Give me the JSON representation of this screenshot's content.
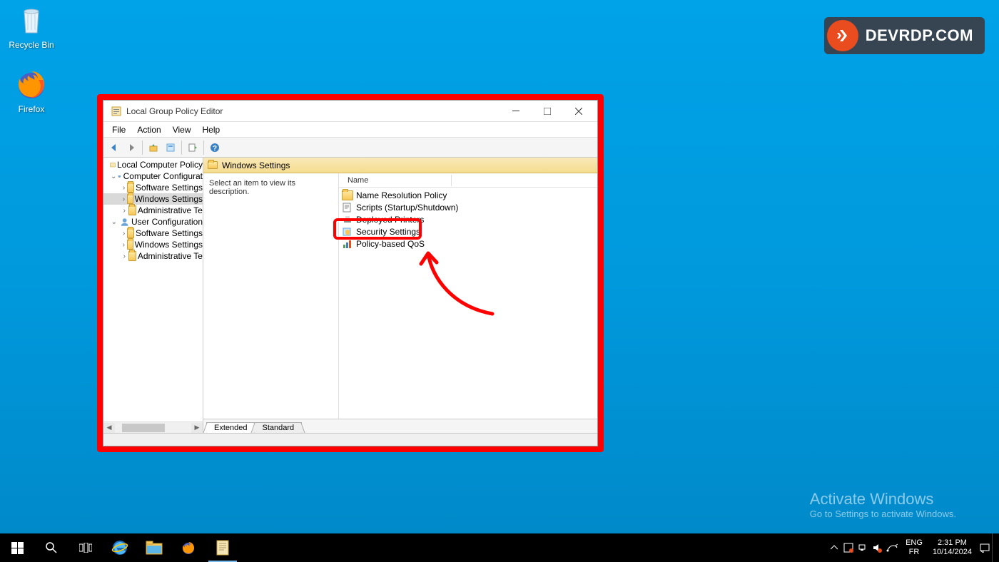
{
  "desktop": {
    "recycle_bin": "Recycle Bin",
    "firefox": "Firefox"
  },
  "brand": {
    "text": "DEVRDP.COM"
  },
  "activate": {
    "title": "Activate Windows",
    "sub": "Go to Settings to activate Windows."
  },
  "window": {
    "title": "Local Group Policy Editor",
    "menu": {
      "file": "File",
      "action": "Action",
      "view": "View",
      "help": "Help"
    },
    "tree": {
      "root": "Local Computer Policy",
      "cc": "Computer Configurat",
      "cc_sw": "Software Settings",
      "cc_win": "Windows Settings",
      "cc_adm": "Administrative Te",
      "uc": "User Configuration",
      "uc_sw": "Software Settings",
      "uc_win": "Windows Settings",
      "uc_adm": "Administrative Te"
    },
    "content": {
      "header": "Windows Settings",
      "desc": "Select an item to view its description.",
      "col_name": "Name",
      "items": {
        "nrp": "Name Resolution Policy",
        "scripts": "Scripts (Startup/Shutdown)",
        "deployed": "Deployed Printers",
        "security": "Security Settings",
        "qos": "Policy-based QoS"
      }
    },
    "tabs": {
      "extended": "Extended",
      "standard": "Standard"
    }
  },
  "taskbar": {
    "lang1": "ENG",
    "lang2": "FR",
    "time": "2:31 PM",
    "date": "10/14/2024"
  }
}
